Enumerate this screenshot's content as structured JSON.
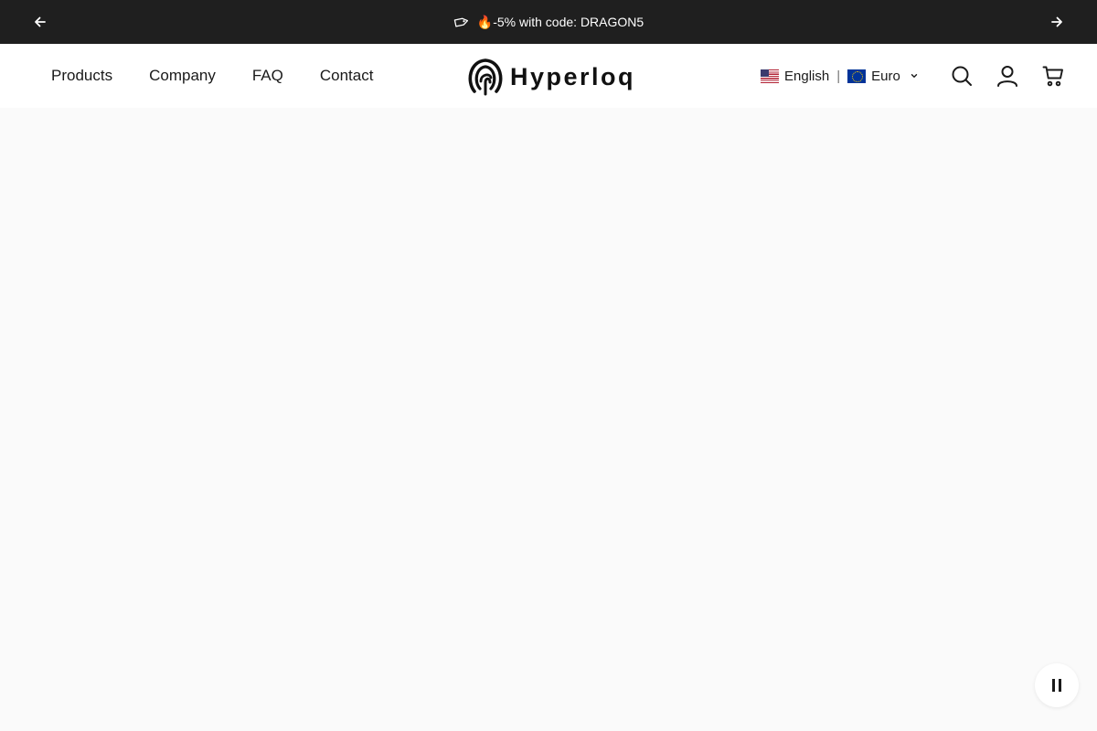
{
  "announcement": {
    "message": "🔥-5% with code: DRAGON5",
    "icons": {
      "prev": "arrow-left-icon",
      "next": "arrow-right-icon",
      "tag": "tag-icon"
    },
    "background": "#1f1f1f",
    "text_color": "#ffffff"
  },
  "nav": {
    "items": [
      {
        "label": "Products"
      },
      {
        "label": "Company"
      },
      {
        "label": "FAQ"
      },
      {
        "label": "Contact"
      }
    ]
  },
  "logo": {
    "text": "Hyperloq",
    "icon": "fingerprint-pin-icon"
  },
  "locale": {
    "language": "English",
    "separator": "|",
    "currency": "Euro",
    "language_flag": "us-flag-icon",
    "currency_flag": "eu-flag-icon"
  },
  "header_icons": [
    "search-icon",
    "account-icon",
    "cart-icon"
  ],
  "hero": {
    "background": "#fafafa",
    "control_icon": "pause-icon"
  }
}
